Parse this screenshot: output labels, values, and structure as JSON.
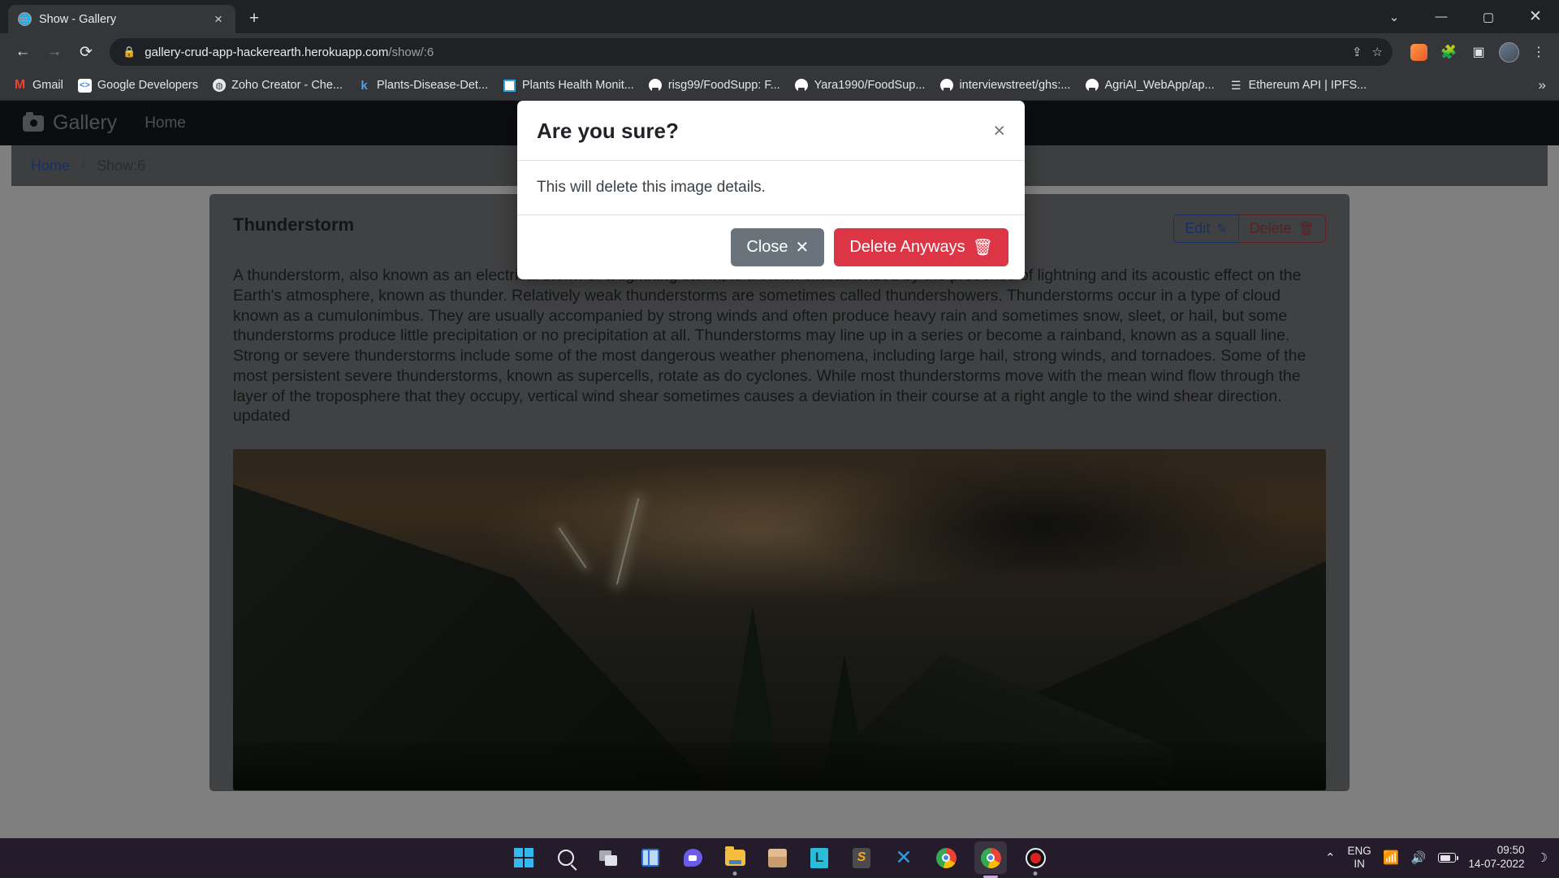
{
  "browser": {
    "tab": {
      "title": "Show - Gallery",
      "favicon_icon": "globe-icon",
      "close_icon": "×",
      "new_tab_icon": "+"
    },
    "window_controls": {
      "minimize": "—",
      "maximize": "▢",
      "close": "✕",
      "chevron": "⌄"
    },
    "nav": {
      "back_icon": "←",
      "forward_icon": "→",
      "reload_icon": "⟳"
    },
    "omnibox": {
      "lock_icon": "🔒",
      "url_main": "gallery-crud-app-hackerearth.herokuapp.com",
      "url_path": "/show/:6",
      "share_icon": "⇪",
      "bookmark_star_icon": "☆"
    },
    "toolbar_icons": [
      "extension-fox-icon",
      "puzzle-extensions-icon",
      "side-panel-icon",
      "profile-avatar",
      "kebab-menu-icon"
    ],
    "bookmarks": [
      {
        "label": "Gmail",
        "icon": "gmail-icon"
      },
      {
        "label": "Google Developers",
        "icon": "google-developers-icon"
      },
      {
        "label": "Zoho Creator - Che...",
        "icon": "globe-icon"
      },
      {
        "label": "Plants-Disease-Det...",
        "icon": "kaggle-icon"
      },
      {
        "label": "Plants Health Monit...",
        "icon": "square-icon"
      },
      {
        "label": "risg99/FoodSupp: F...",
        "icon": "github-icon"
      },
      {
        "label": "Yara1990/FoodSup...",
        "icon": "github-icon"
      },
      {
        "label": "interviewstreet/ghs:...",
        "icon": "github-icon"
      },
      {
        "label": "AgriAI_WebApp/ap...",
        "icon": "github-icon"
      },
      {
        "label": "Ethereum API | IPFS...",
        "icon": "ethereum-icon"
      }
    ],
    "bookmarks_overflow_icon": "»"
  },
  "page": {
    "navbar": {
      "brand": "Gallery",
      "brand_icon": "camera-icon",
      "links": [
        "Home"
      ]
    },
    "breadcrumb": {
      "home": "Home",
      "separator": "/",
      "current": "Show:6"
    },
    "card": {
      "title": "Thunderstorm",
      "edit_label": "Edit",
      "edit_icon": "pencil-square-icon",
      "delete_label": "Delete",
      "delete_icon": "trash-icon",
      "body": "A thunderstorm, also known as an electrical storm or a lightning storm, is a storm characterized by the presence of lightning and its acoustic effect on the Earth's atmosphere, known as thunder. Relatively weak thunderstorms are sometimes called thundershowers. Thunderstorms occur in a type of cloud known as a cumulonimbus. They are usually accompanied by strong winds and often produce heavy rain and sometimes snow, sleet, or hail, but some thunderstorms produce little precipitation or no precipitation at all. Thunderstorms may line up in a series or become a rainband, known as a squall line. Strong or severe thunderstorms include some of the most dangerous weather phenomena, including large hail, strong winds, and tornadoes. Some of the most persistent severe thunderstorms, known as supercells, rotate as do cyclones. While most thunderstorms move with the mean wind flow through the layer of the troposphere that they occupy, vertical wind shear sometimes causes a deviation in their course at a right angle to the wind shear direction. updated",
      "image_alt": "thunderstorm-photo"
    },
    "modal": {
      "title": "Are you sure?",
      "close_x_icon": "×",
      "body": "This will delete this image details.",
      "close_label": "Close",
      "close_icon": "✕",
      "confirm_label": "Delete Anyways",
      "confirm_icon": "trash-icon",
      "confirm_color": "#dc3545",
      "close_color": "#6a737c"
    }
  },
  "taskbar": {
    "apps": [
      {
        "name": "start-button",
        "icon": "windows-logo-icon"
      },
      {
        "name": "search-button",
        "icon": "search-icon"
      },
      {
        "name": "task-view-button",
        "icon": "task-view-icon"
      },
      {
        "name": "widgets-button",
        "icon": "widgets-icon"
      },
      {
        "name": "teams-chat-button",
        "icon": "teams-icon"
      },
      {
        "name": "file-explorer-button",
        "icon": "folder-icon"
      },
      {
        "name": "package-app-button",
        "icon": "box-icon"
      },
      {
        "name": "lightshot-app-button",
        "icon": "letter-l-icon"
      },
      {
        "name": "sublime-text-button",
        "icon": "sublime-icon"
      },
      {
        "name": "vs-code-button",
        "icon": "vscode-icon"
      },
      {
        "name": "chrome-button",
        "icon": "chrome-icon"
      },
      {
        "name": "chrome-active-button",
        "icon": "chrome-icon"
      },
      {
        "name": "screen-recorder-button",
        "icon": "record-icon"
      }
    ],
    "tray": {
      "chevron_icon": "⌃",
      "language_primary": "ENG",
      "language_secondary": "IN",
      "wifi_icon": "wifi-icon",
      "volume_icon": "speaker-icon",
      "battery_icon": "battery-icon",
      "time": "09:50",
      "date": "14-07-2022",
      "notification_icon": "moon-icon"
    }
  }
}
